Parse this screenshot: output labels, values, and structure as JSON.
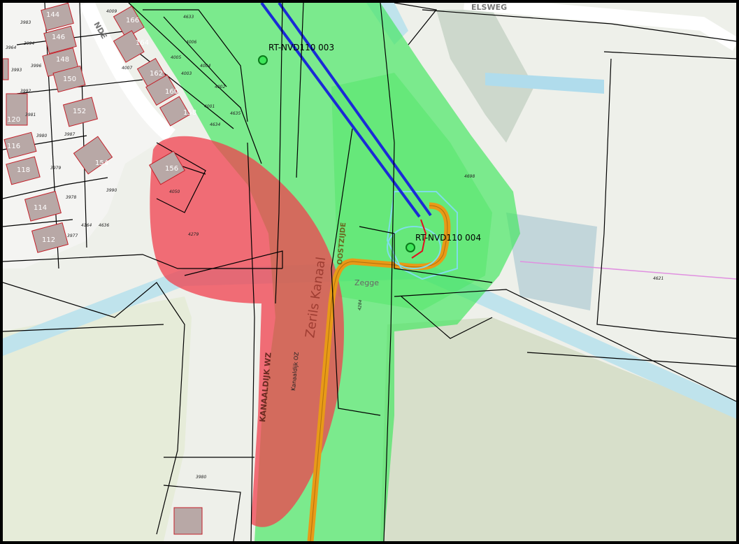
{
  "map": {
    "tower_labels": [
      "RT-NVD110 003",
      "RT-NVD110 004"
    ],
    "street_labels": {
      "top_right": "ELSWEG",
      "top_left": "NDE",
      "road_vertical": "KANAALDIJK WZ",
      "road_vertical_east": "OOSTZIJDE",
      "canal_name": "Zerils Kanaal",
      "canal_small": "Kanaaldijk OZ"
    },
    "place_labels": {
      "zegge": "Zegge"
    },
    "parcel_numbers": [
      "3983",
      "3994",
      "3964",
      "3996",
      "3993",
      "3992",
      "3981",
      "3980",
      "3987",
      "3979",
      "3978",
      "3977",
      "4164",
      "4636",
      "4635",
      "4009",
      "4007",
      "4006",
      "4005",
      "4003",
      "4004",
      "4002",
      "4001",
      "4634",
      "4633",
      "3990",
      "4698",
      "4050",
      "4279",
      "4284",
      "3980",
      "4621",
      "4696"
    ],
    "house_numbers": [
      "144",
      "146",
      "148",
      "150",
      "152",
      "154",
      "156",
      "158",
      "160",
      "162",
      "164",
      "166",
      "116",
      "118",
      "120",
      "114",
      "112",
      "158"
    ],
    "colors": {
      "green_zone": "#3ee65a",
      "red_zone": "#f0404e",
      "power_line": "#1a2bd6",
      "cable": "#e89a17",
      "water": "#bfe3ec",
      "building": "#b8a8a6",
      "building_outline": "#c4202a"
    }
  }
}
